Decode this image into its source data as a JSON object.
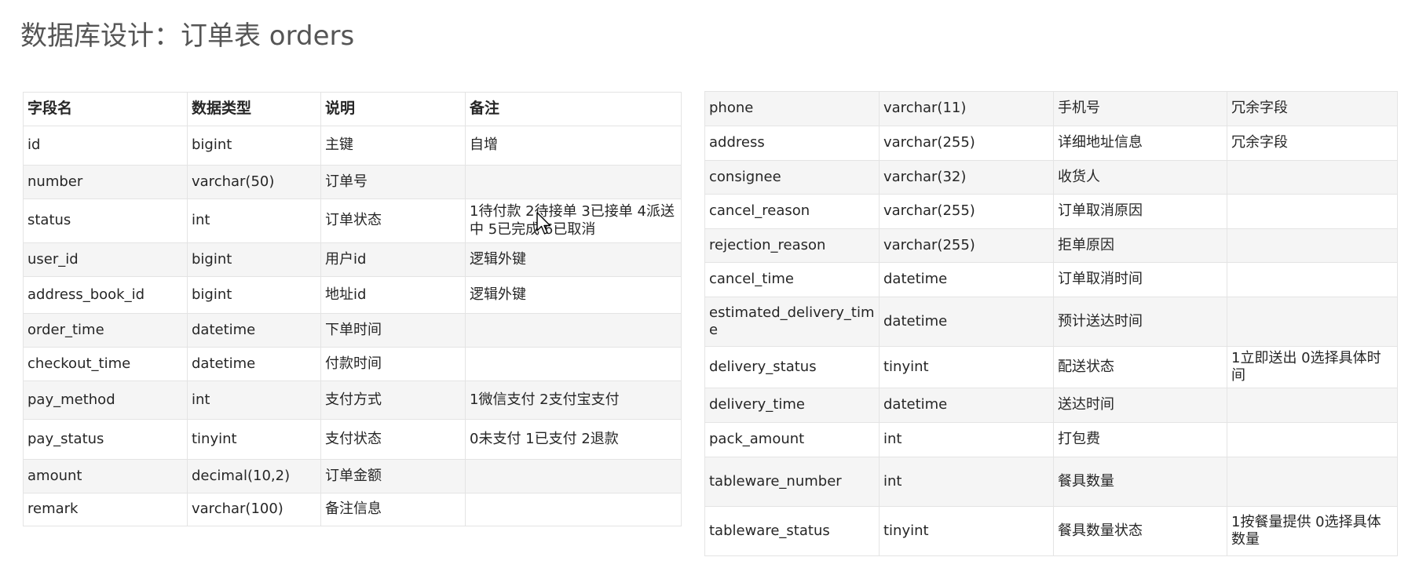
{
  "title": "数据库设计：订单表 orders",
  "left_table": {
    "headers": [
      "字段名",
      "数据类型",
      "说明",
      "备注"
    ],
    "rows": [
      [
        "id",
        "bigint",
        "主键",
        "自增"
      ],
      [
        "number",
        "varchar(50)",
        "订单号",
        ""
      ],
      [
        "status",
        "int",
        "订单状态",
        "1待付款 2待接单 3已接单 4派送中 5已完成 6已取消"
      ],
      [
        "user_id",
        "bigint",
        "用户id",
        "逻辑外键"
      ],
      [
        "address_book_id",
        "bigint",
        "地址id",
        "逻辑外键"
      ],
      [
        "order_time",
        "datetime",
        "下单时间",
        ""
      ],
      [
        "checkout_time",
        "datetime",
        "付款时间",
        ""
      ],
      [
        "pay_method",
        "int",
        "支付方式",
        "1微信支付 2支付宝支付"
      ],
      [
        "pay_status",
        "tinyint",
        "支付状态",
        "0未支付 1已支付 2退款"
      ],
      [
        "amount",
        "decimal(10,2)",
        "订单金额",
        ""
      ],
      [
        "remark",
        "varchar(100)",
        "备注信息",
        ""
      ]
    ]
  },
  "right_table": {
    "rows": [
      [
        "phone",
        "varchar(11)",
        "手机号",
        "冗余字段"
      ],
      [
        "address",
        "varchar(255)",
        "详细地址信息",
        "冗余字段"
      ],
      [
        "consignee",
        "varchar(32)",
        "收货人",
        ""
      ],
      [
        "cancel_reason",
        "varchar(255)",
        "订单取消原因",
        ""
      ],
      [
        "rejection_reason",
        "varchar(255)",
        "拒单原因",
        ""
      ],
      [
        "cancel_time",
        "datetime",
        "订单取消时间",
        ""
      ],
      [
        "estimated_delivery_time",
        "datetime",
        "预计送达时间",
        ""
      ],
      [
        "delivery_status",
        "tinyint",
        "配送状态",
        "1立即送出 0选择具体时间"
      ],
      [
        "delivery_time",
        "datetime",
        "送达时间",
        ""
      ],
      [
        "pack_amount",
        "int",
        "打包费",
        ""
      ],
      [
        "tableware_number",
        "int",
        "餐具数量",
        ""
      ],
      [
        "tableware_status",
        "tinyint",
        "餐具数量状态",
        "1按餐量提供 0选择具体数量"
      ]
    ]
  }
}
